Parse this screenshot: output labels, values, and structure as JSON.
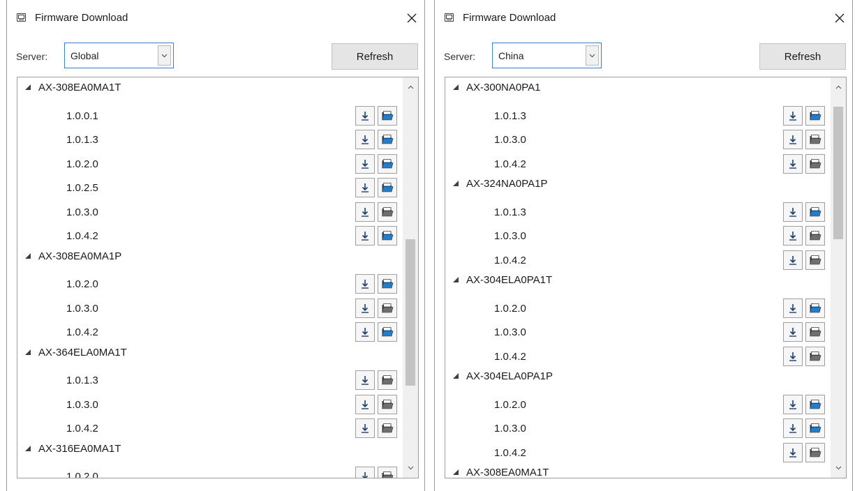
{
  "windows": [
    {
      "title": "Firmware Download",
      "server_label": "Server:",
      "server_value": "Global",
      "refresh_label": "Refresh",
      "folder_color": "#1e7fd0",
      "models": [
        {
          "name": "AX-308EA0MA1T",
          "versions": [
            {
              "v": "1.0.0.1",
              "local": true
            },
            {
              "v": "1.0.1.3",
              "local": true
            },
            {
              "v": "1.0.2.0",
              "local": true
            },
            {
              "v": "1.0.2.5",
              "local": true
            },
            {
              "v": "1.0.3.0",
              "local": false
            },
            {
              "v": "1.0.4.2",
              "local": true
            }
          ]
        },
        {
          "name": "AX-308EA0MA1P",
          "versions": [
            {
              "v": "1.0.2.0",
              "local": true
            },
            {
              "v": "1.0.3.0",
              "local": false
            },
            {
              "v": "1.0.4.2",
              "local": true
            }
          ]
        },
        {
          "name": "AX-364ELA0MA1T",
          "versions": [
            {
              "v": "1.0.1.3",
              "local": false
            },
            {
              "v": "1.0.3.0",
              "local": false
            },
            {
              "v": "1.0.4.2",
              "local": false
            }
          ]
        },
        {
          "name": "AX-316EA0MA1T",
          "versions": [
            {
              "v": "1.0.2.0",
              "local": false
            }
          ]
        }
      ]
    },
    {
      "title": "Firmware Download",
      "server_label": "Server:",
      "server_value": "China",
      "refresh_label": "Refresh",
      "folder_color": "#1e7fd0",
      "models": [
        {
          "name": "AX-300NA0PA1",
          "versions": [
            {
              "v": "1.0.1.3",
              "local": true
            },
            {
              "v": "1.0.3.0",
              "local": false
            },
            {
              "v": "1.0.4.2",
              "local": false
            }
          ]
        },
        {
          "name": "AX-324NA0PA1P",
          "versions": [
            {
              "v": "1.0.1.3",
              "local": true
            },
            {
              "v": "1.0.3.0",
              "local": false
            },
            {
              "v": "1.0.4.2",
              "local": false
            }
          ]
        },
        {
          "name": "AX-304ELA0PA1T",
          "versions": [
            {
              "v": "1.0.2.0",
              "local": true
            },
            {
              "v": "1.0.3.0",
              "local": false
            },
            {
              "v": "1.0.4.2",
              "local": false
            }
          ]
        },
        {
          "name": "AX-304ELA0PA1P",
          "versions": [
            {
              "v": "1.0.2.0",
              "local": true
            },
            {
              "v": "1.0.3.0",
              "local": true
            },
            {
              "v": "1.0.4.2",
              "local": false
            }
          ]
        },
        {
          "name": "AX-308EA0MA1T",
          "versions": []
        }
      ]
    }
  ]
}
